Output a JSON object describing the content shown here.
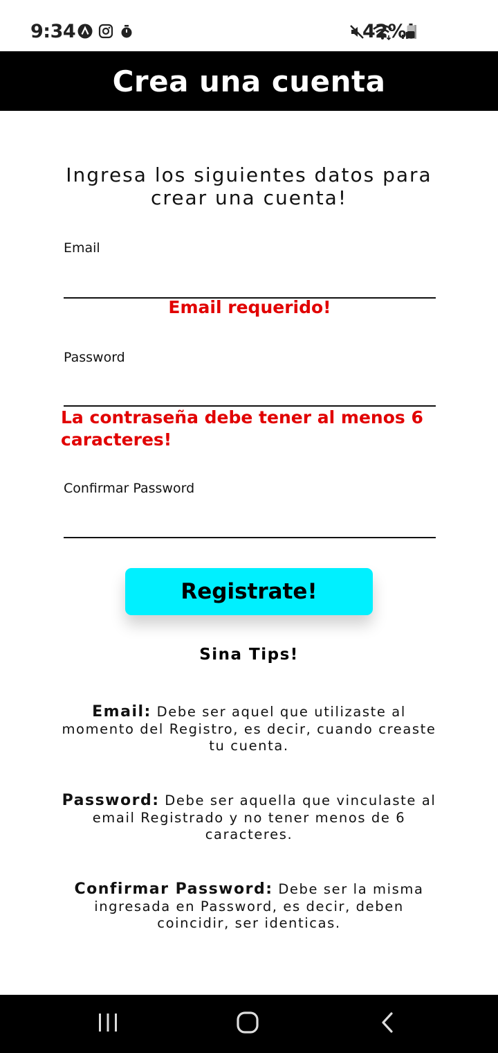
{
  "status_bar": {
    "time": "9:34",
    "battery": "42%"
  },
  "header": {
    "title": "Crea una cuenta"
  },
  "intro": {
    "text": "Ingresa los siguientes datos para crear una cuenta!"
  },
  "form": {
    "email": {
      "label": "Email",
      "value": "",
      "error": "Email requerido!"
    },
    "password": {
      "label": "Password",
      "value": "",
      "error": "La contraseña debe tener al menos 6 caracteres!"
    },
    "confirm_password": {
      "label": "Confirmar Password",
      "value": ""
    },
    "submit_label": "Registrate!"
  },
  "tips": {
    "title": "Sina Tips!",
    "items": [
      {
        "label": "Email:",
        "text": " Debe ser aquel que utilizaste al momento del Registro, es decir, cuando creaste tu cuenta."
      },
      {
        "label": "Password:",
        "text": " Debe ser aquella que vinculaste al email Registrado y no tener menos de 6 caracteres."
      },
      {
        "label": "Confirmar Password:",
        "text": " Debe ser la misma ingresada en Password, es decir, deben coincidir, ser identicas."
      }
    ]
  },
  "colors": {
    "header_bg": "#000000",
    "button_bg": "#00f0ff",
    "error": "#e10000"
  },
  "icons": {
    "status_left": [
      "app-a-icon",
      "instagram-icon",
      "timer-icon"
    ],
    "status_right": [
      "mute-icon",
      "wifi-icon",
      "signal-icon",
      "battery-icon"
    ],
    "nav": [
      "recents-icon",
      "home-icon",
      "back-icon"
    ]
  }
}
